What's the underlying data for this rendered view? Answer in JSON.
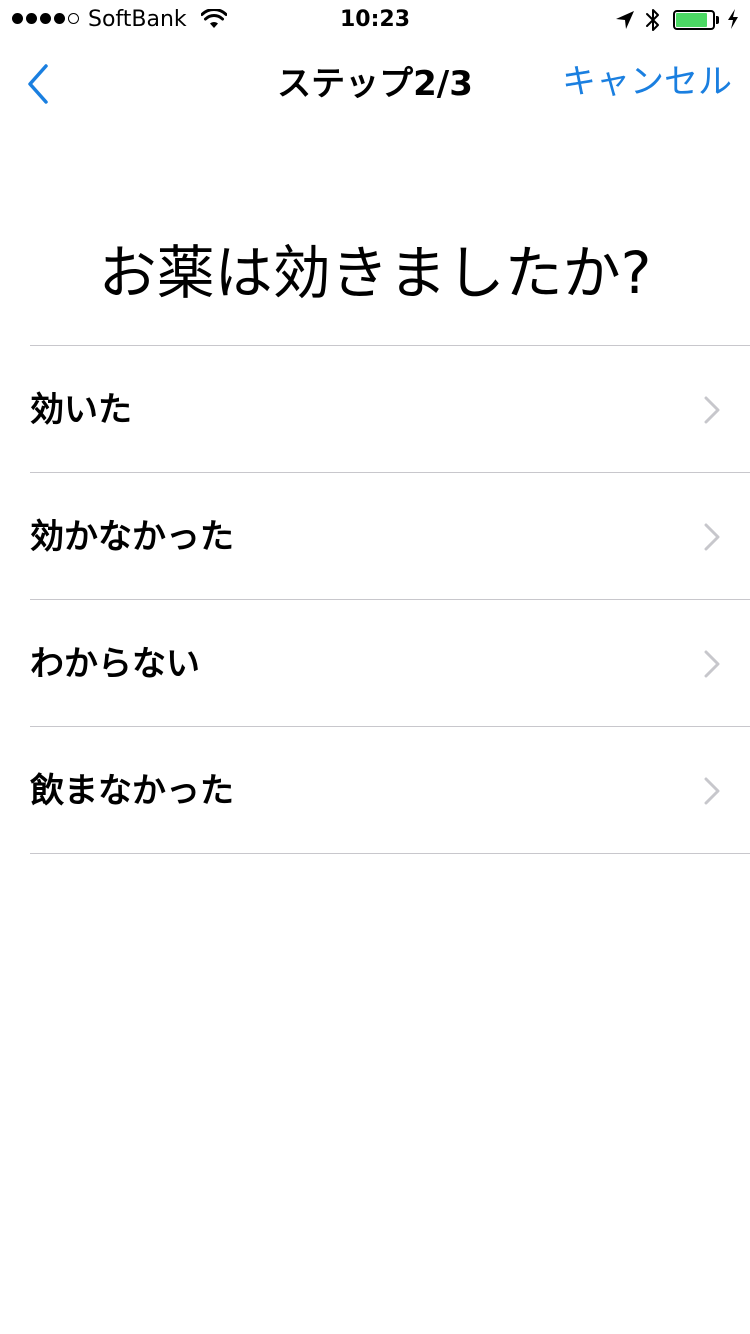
{
  "status_bar": {
    "carrier": "SoftBank",
    "time": "10:23",
    "signal_bars_filled": 4,
    "signal_bars_total": 5,
    "battery_level_fraction": 0.85,
    "battery_color": "#4cd964"
  },
  "nav": {
    "back_icon": "chevron-left-icon",
    "title": "ステップ2/3",
    "cancel_label": "キャンセル",
    "accent_color": "#1a7fe0"
  },
  "question": "お薬は効きましたか?",
  "options": [
    {
      "label": "効いた"
    },
    {
      "label": "効かなかった"
    },
    {
      "label": "わからない"
    },
    {
      "label": "飲まなかった"
    }
  ]
}
